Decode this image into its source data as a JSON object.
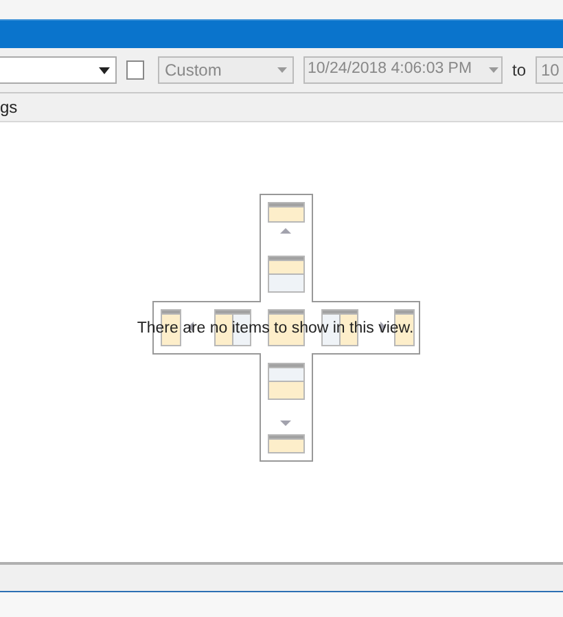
{
  "toolbar": {
    "checkbox": {
      "checked": false
    },
    "range_combo": {
      "value": "Custom"
    },
    "from_date": {
      "value": "10/24/2018 4:06:03 PM"
    },
    "to_label": "to",
    "to_date": {
      "value": "10"
    }
  },
  "column_header": "gs",
  "empty_message": "There are no items to show in this view."
}
